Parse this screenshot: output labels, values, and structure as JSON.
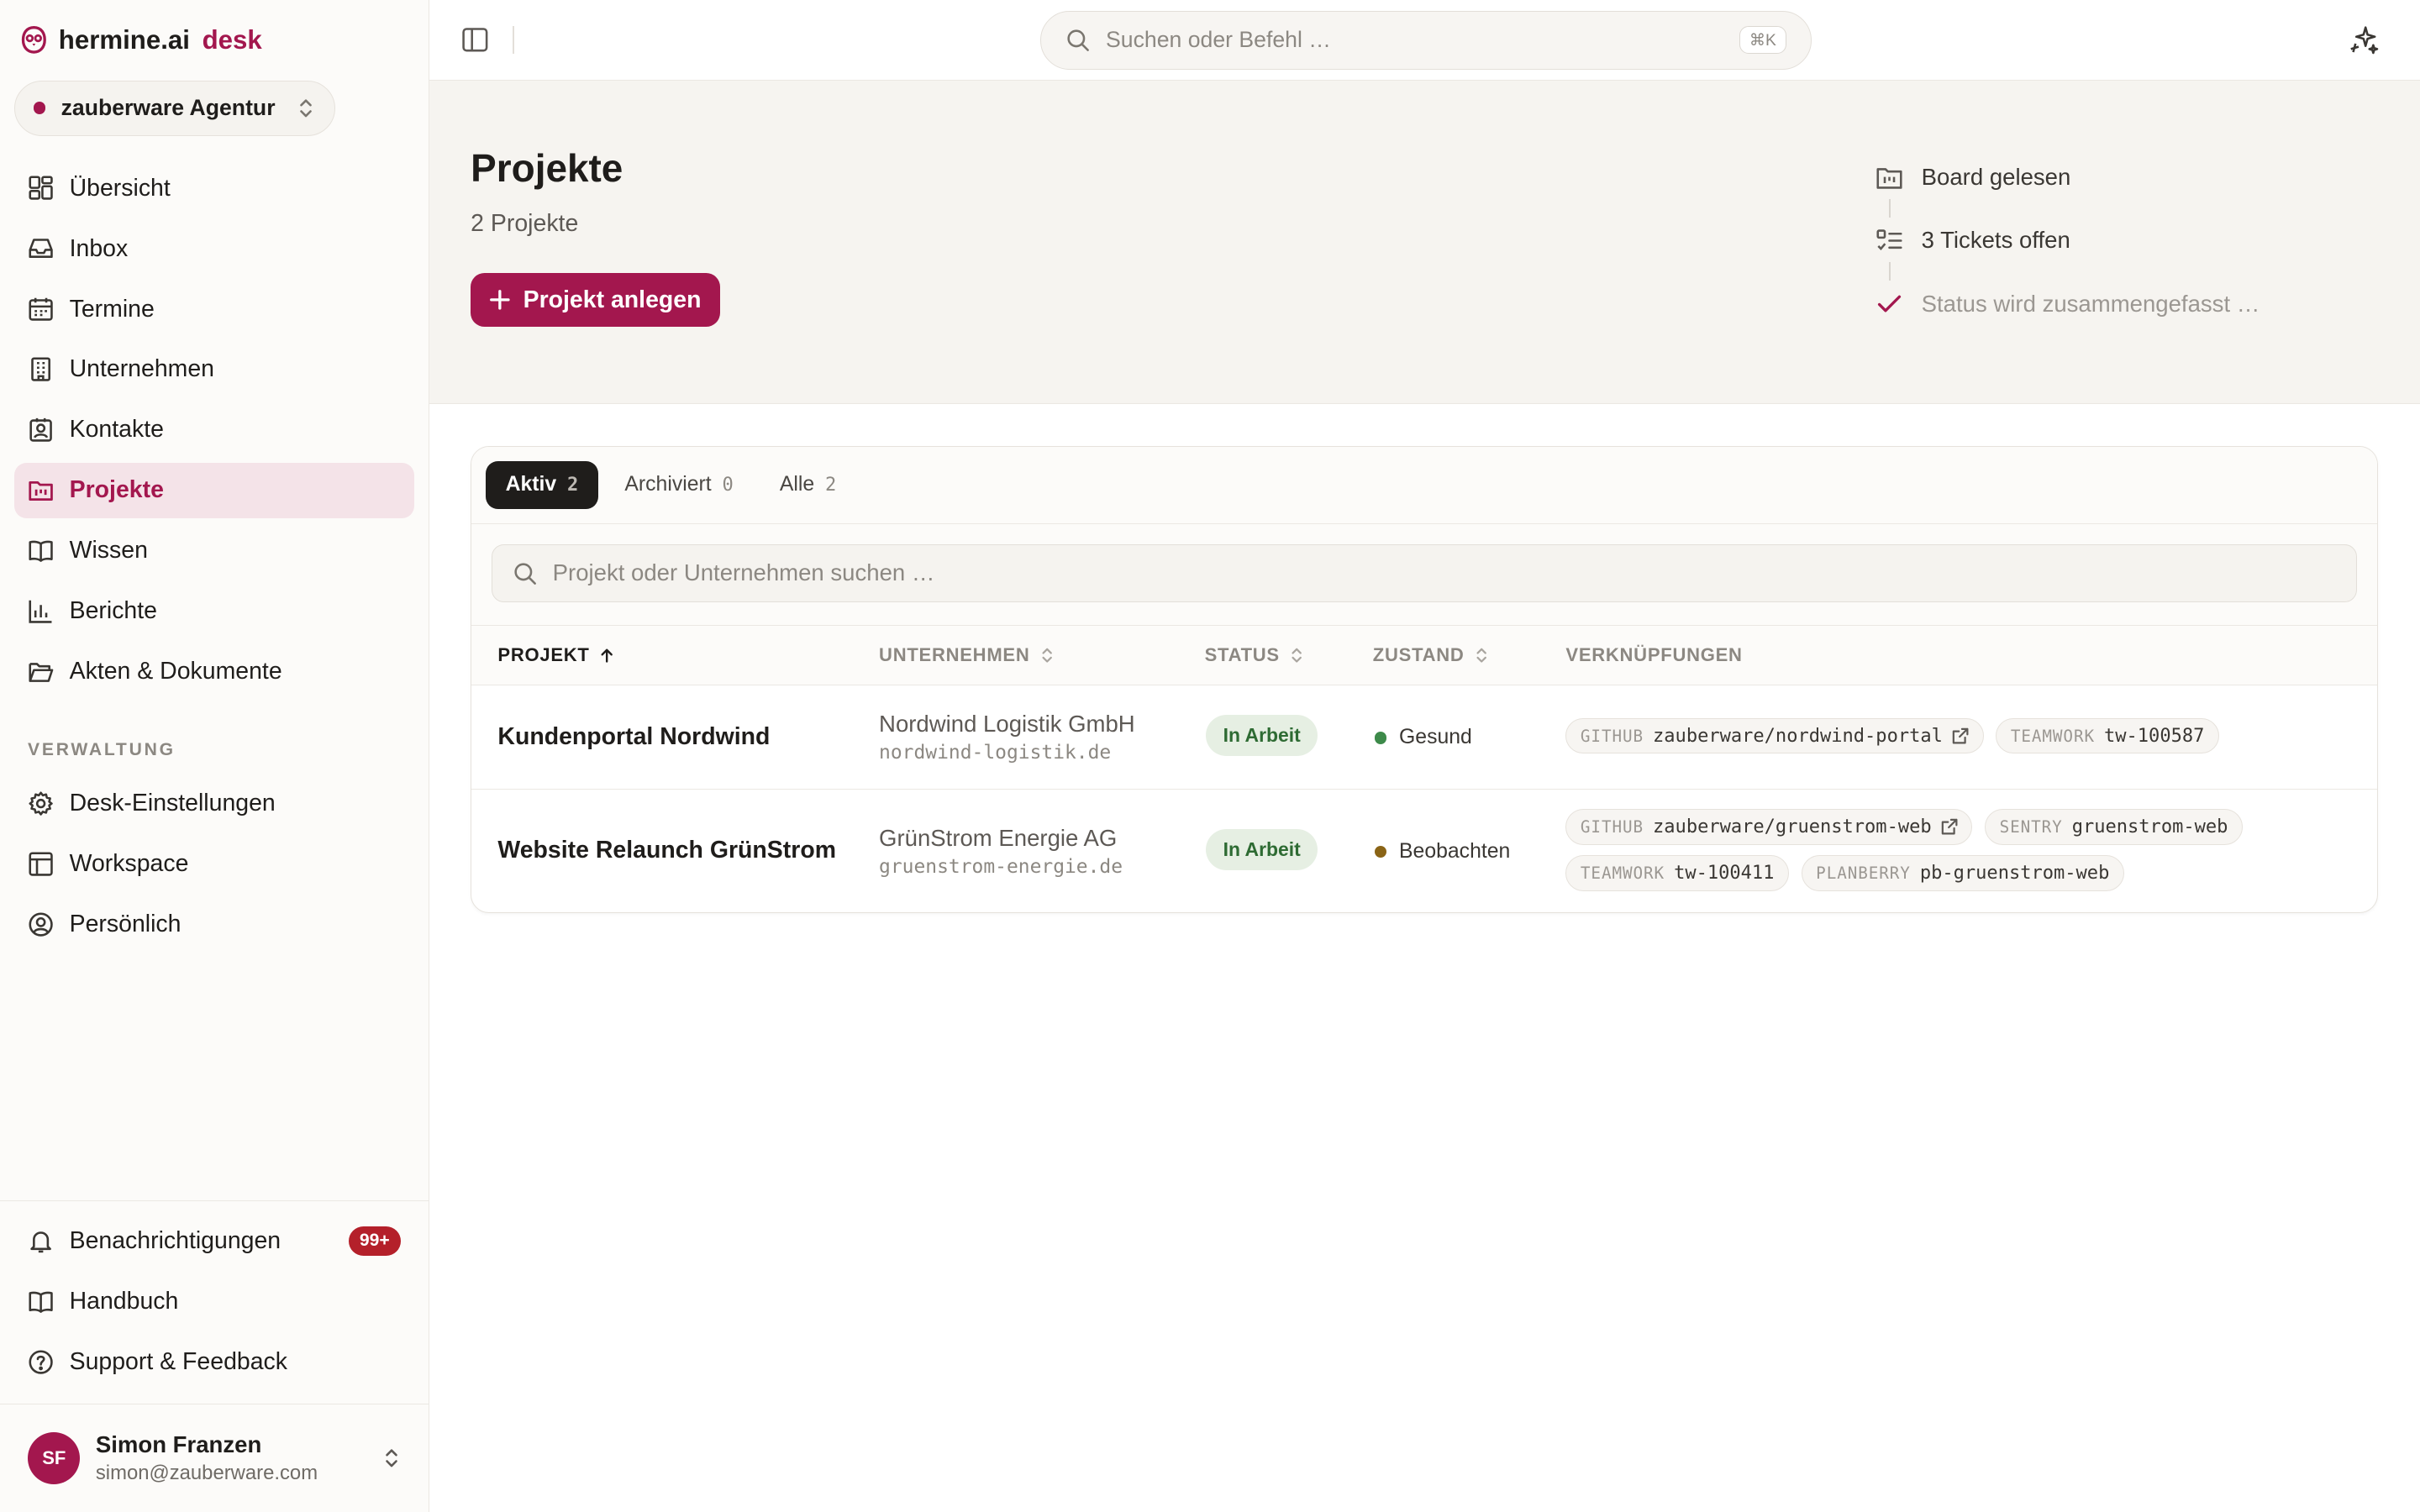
{
  "brand": {
    "name": "hermine.ai",
    "product": "desk",
    "accent": "#a3174e"
  },
  "workspace": {
    "name": "zauberware Agentur"
  },
  "nav": [
    {
      "label": "Übersicht",
      "icon": "dashboard-icon"
    },
    {
      "label": "Inbox",
      "icon": "inbox-icon"
    },
    {
      "label": "Termine",
      "icon": "calendar-icon"
    },
    {
      "label": "Unternehmen",
      "icon": "building-icon"
    },
    {
      "label": "Kontakte",
      "icon": "contact-icon"
    },
    {
      "label": "Projekte",
      "icon": "project-icon",
      "active": true
    },
    {
      "label": "Wissen",
      "icon": "book-icon"
    },
    {
      "label": "Berichte",
      "icon": "chart-icon"
    },
    {
      "label": "Akten & Dokumente",
      "icon": "folder-icon"
    }
  ],
  "admin_section": {
    "label": "VERWALTUNG",
    "items": [
      {
        "label": "Desk-Einstellungen",
        "icon": "gear-icon"
      },
      {
        "label": "Workspace",
        "icon": "layout-icon"
      },
      {
        "label": "Persönlich",
        "icon": "user-circle-icon"
      }
    ]
  },
  "bottom_nav": [
    {
      "label": "Benachrichtigungen",
      "icon": "bell-icon",
      "badge": "99+"
    },
    {
      "label": "Handbuch",
      "icon": "book-icon"
    },
    {
      "label": "Support & Feedback",
      "icon": "help-icon"
    }
  ],
  "user": {
    "initials": "SF",
    "name": "Simon Franzen",
    "email": "simon@zauberware.com"
  },
  "topbar": {
    "search_placeholder": "Suchen oder Befehl …",
    "shortcut": "⌘K"
  },
  "page": {
    "title": "Projekte",
    "subtitle": "2 Projekte",
    "create_label": "Projekt anlegen"
  },
  "activity": [
    {
      "text": "Board gelesen",
      "icon": "board-icon",
      "muted": false
    },
    {
      "text": "3 Tickets offen",
      "icon": "checklist-icon",
      "muted": false
    },
    {
      "text": "Status wird zusammengefasst …",
      "icon": "check-icon",
      "muted": true
    }
  ],
  "tabs": [
    {
      "label": "Aktiv",
      "count": "2",
      "active": true
    },
    {
      "label": "Archiviert",
      "count": "0"
    },
    {
      "label": "Alle",
      "count": "2"
    }
  ],
  "filter": {
    "placeholder": "Projekt oder Unternehmen suchen …"
  },
  "columns": {
    "project": "PROJEKT",
    "company": "UNTERNEHMEN",
    "status": "STATUS",
    "state": "ZUSTAND",
    "links": "VERKNÜPFUNGEN"
  },
  "rows": [
    {
      "project": "Kundenportal Nordwind",
      "company": "Nordwind Logistik GmbH",
      "domain": "nordwind-logistik.de",
      "status": "In Arbeit",
      "state": "Gesund",
      "state_color": "#3d8a4a",
      "links": [
        {
          "key": "GITHUB",
          "value": "zauberware/nordwind-portal",
          "external": true
        },
        {
          "key": "TEAMWORK",
          "value": "tw-100587"
        }
      ]
    },
    {
      "project": "Website Relaunch GrünStrom",
      "company": "GrünStrom Energie AG",
      "domain": "gruenstrom-energie.de",
      "status": "In Arbeit",
      "state": "Beobachten",
      "state_color": "#8a6416",
      "links": [
        {
          "key": "GITHUB",
          "value": "zauberware/gruenstrom-web",
          "external": true
        },
        {
          "key": "SENTRY",
          "value": "gruenstrom-web"
        },
        {
          "key": "TEAMWORK",
          "value": "tw-100411"
        },
        {
          "key": "PLANBERRY",
          "value": "pb-gruenstrom-web"
        }
      ]
    }
  ]
}
